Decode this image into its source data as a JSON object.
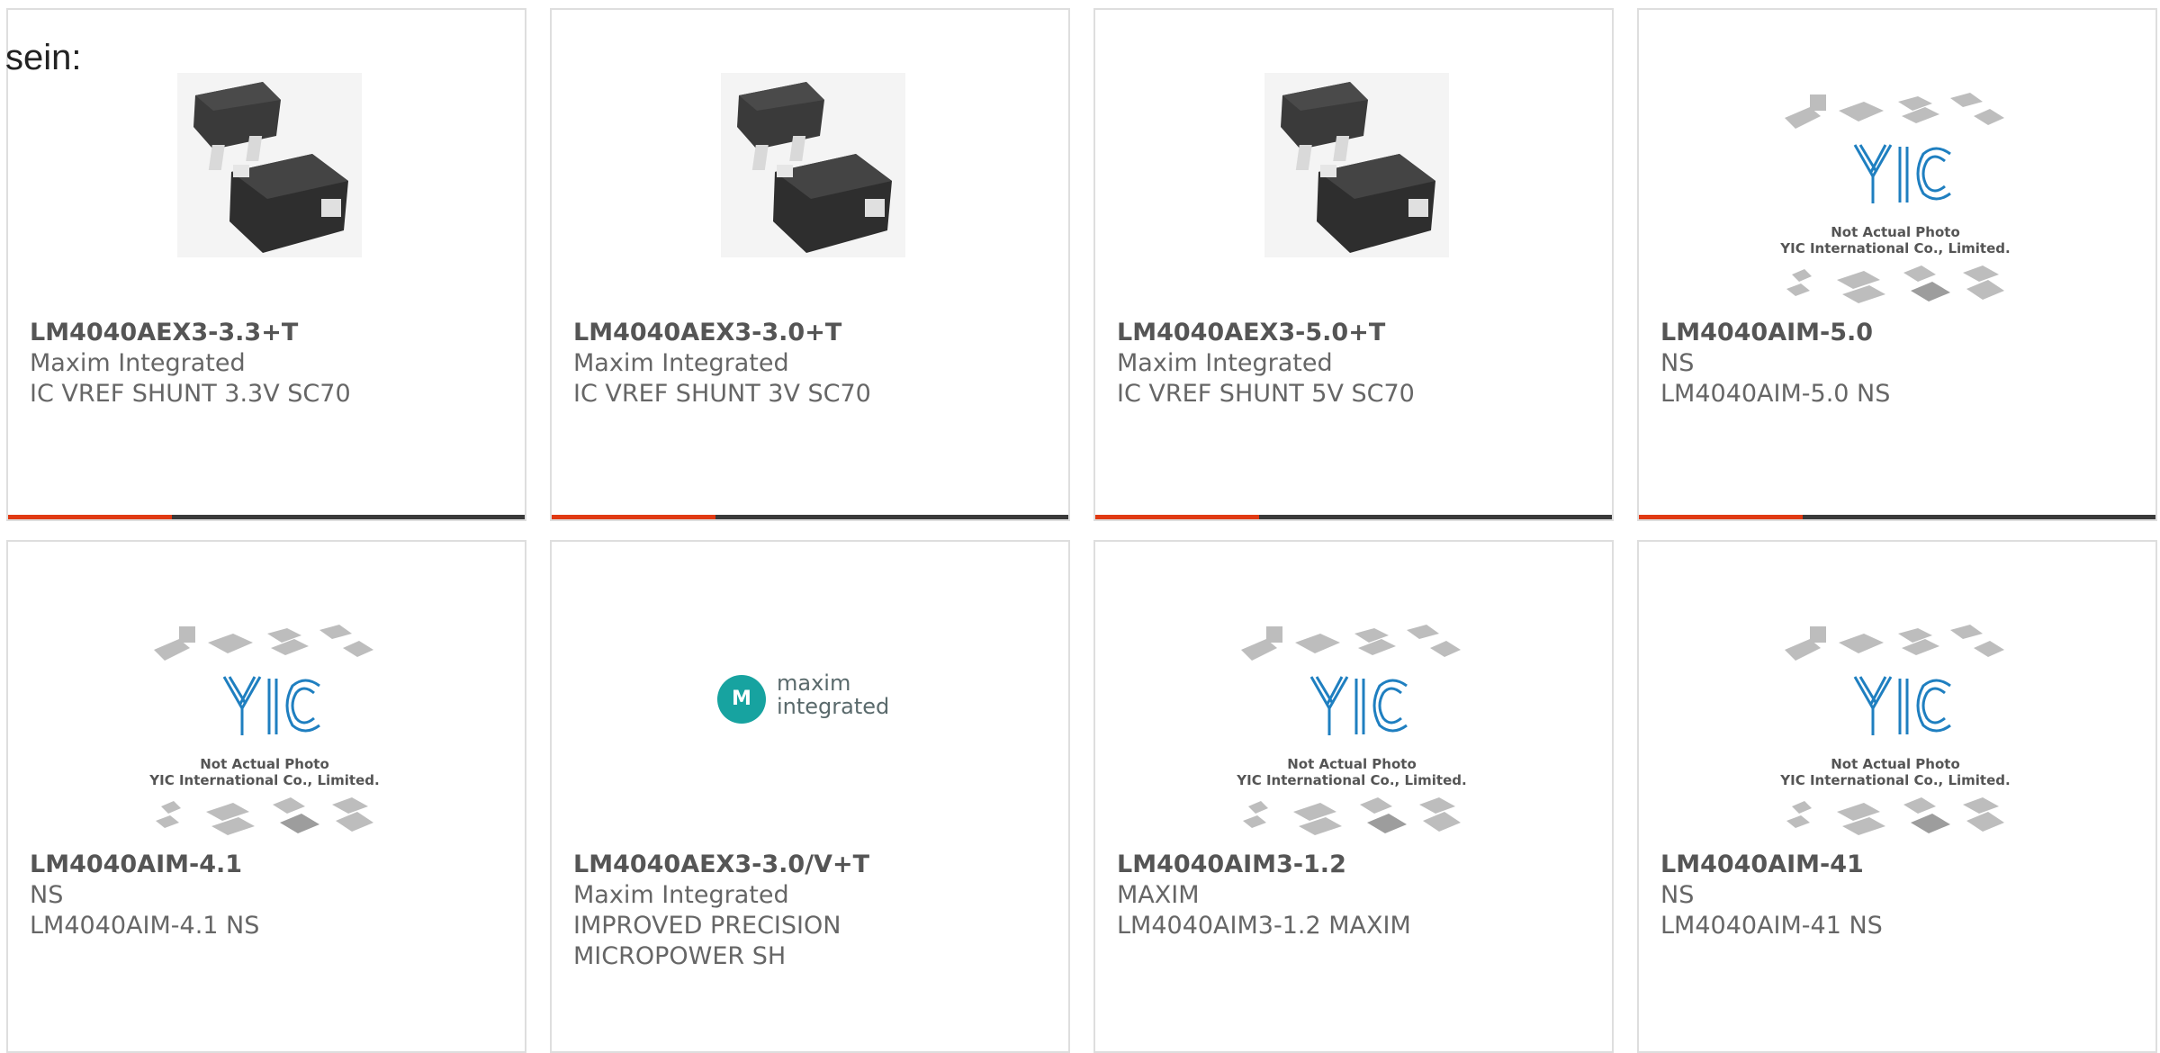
{
  "intro_text": "sein:",
  "placeholder": {
    "line1": "Not Actual Photo",
    "line2": "YIC International Co., Limited."
  },
  "maxim_logo": {
    "mark": "M",
    "line1": "maxim",
    "line2": "integrated"
  },
  "colors": {
    "accent": "#e03a13",
    "bar": "#3a3a3a",
    "maxim_teal": "#17a3a0",
    "yic_blue": "#1f7fc0"
  },
  "products": [
    {
      "part": "LM4040AEX3-3.3+T",
      "manufacturer": "Maxim Integrated",
      "desc": "IC VREF SHUNT 3.3V SC70",
      "image": "sot-component-photo"
    },
    {
      "part": "LM4040AEX3-3.0+T",
      "manufacturer": "Maxim Integrated",
      "desc": "IC VREF SHUNT 3V SC70",
      "image": "sot-component-photo"
    },
    {
      "part": "LM4040AEX3-5.0+T",
      "manufacturer": "Maxim Integrated",
      "desc": "IC VREF SHUNT 5V SC70",
      "image": "sot-component-photo"
    },
    {
      "part": "LM4040AIM-5.0",
      "manufacturer": "NS",
      "desc": "LM4040AIM-5.0 NS",
      "image": "yic-placeholder"
    },
    {
      "part": "LM4040AIM-4.1",
      "manufacturer": "NS",
      "desc": "LM4040AIM-4.1 NS",
      "image": "yic-placeholder"
    },
    {
      "part": "LM4040AEX3-3.0/V+T",
      "manufacturer": "Maxim Integrated",
      "desc": "IMPROVED PRECISION MICROPOWER SH",
      "image": "maxim-logo"
    },
    {
      "part": "LM4040AIM3-1.2",
      "manufacturer": "MAXIM",
      "desc": "LM4040AIM3-1.2 MAXIM",
      "image": "yic-placeholder"
    },
    {
      "part": "LM4040AIM-41",
      "manufacturer": "NS",
      "desc": "LM4040AIM-41 NS",
      "image": "yic-placeholder"
    }
  ]
}
